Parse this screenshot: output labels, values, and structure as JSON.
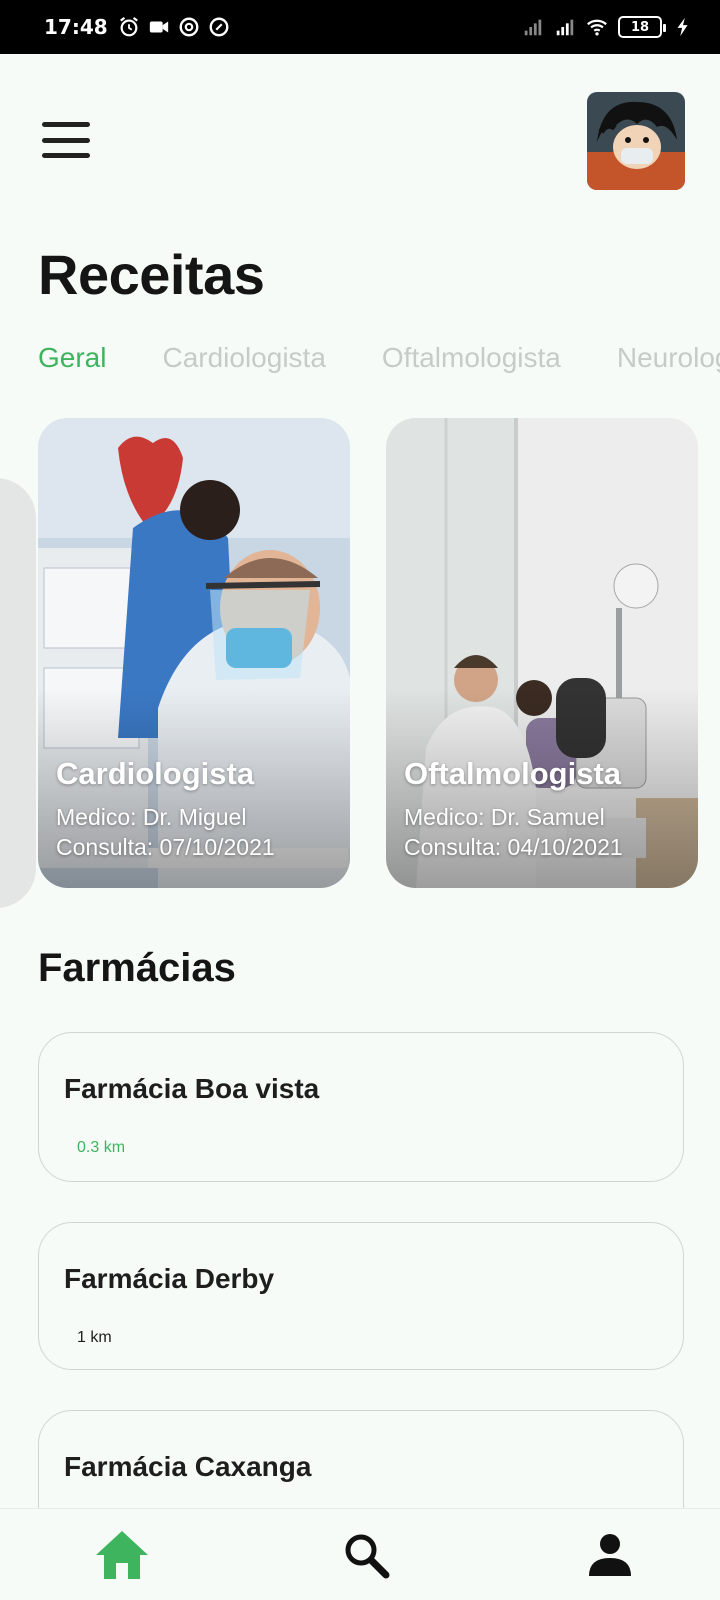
{
  "status_bar": {
    "time": "17:48",
    "battery": "18",
    "icons": [
      "alarm-icon",
      "video-camera-icon",
      "at-sign-icon",
      "at-sign-icon",
      "signal-icon",
      "signal-icon",
      "wifi-icon",
      "battery-icon",
      "charging-icon"
    ]
  },
  "header": {
    "title": "Receitas"
  },
  "tabs": [
    {
      "label": "Geral",
      "active": true
    },
    {
      "label": "Cardiologista",
      "active": false
    },
    {
      "label": "Oftalmologista",
      "active": false
    },
    {
      "label": "Neurologista",
      "active": false
    }
  ],
  "cards": [
    {
      "title": "Cardiologista",
      "doctor": "Medico: Dr. Miguel",
      "date": "Consulta: 07/10/2021"
    },
    {
      "title": "Oftalmologista",
      "doctor": "Medico: Dr. Samuel",
      "date": "Consulta: 04/10/2021"
    }
  ],
  "pharmacies": {
    "title": "Farmácias",
    "items": [
      {
        "name": "Farmácia Boa vista",
        "distance": "0.3 km"
      },
      {
        "name": "Farmácia Derby",
        "distance": "1 km"
      },
      {
        "name": "Farmácia Caxanga",
        "distance": ""
      }
    ]
  },
  "colors": {
    "accent": "#3fb45e",
    "background": "#f6fbf8",
    "inactive_tab": "#c6cbc8"
  },
  "nav": [
    "home-icon",
    "search-icon",
    "profile-icon"
  ]
}
